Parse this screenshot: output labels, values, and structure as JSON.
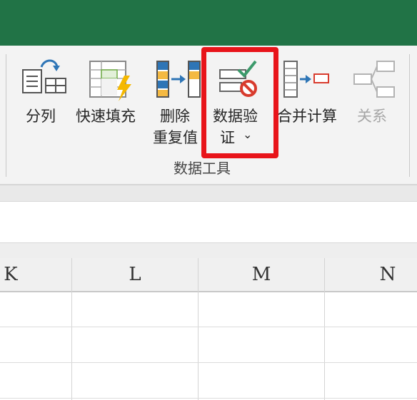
{
  "ribbon": {
    "commands": {
      "text_to_columns": "分列",
      "flash_fill": "快速填充",
      "remove_duplicates_line1": "删除",
      "remove_duplicates_line2": "重复值",
      "data_validation_line1": "数据验",
      "data_validation_line2": "证",
      "data_validation_arrow": "⌄",
      "consolidate": "合并计算",
      "relationships": "关系"
    },
    "group_label": "数据工具",
    "highlight_color": "#e8141a"
  },
  "grid": {
    "columns": [
      "K",
      "L",
      "M",
      "N"
    ]
  },
  "colors": {
    "titlebar": "#217346",
    "ribbon_bg": "#f3f3f3"
  }
}
